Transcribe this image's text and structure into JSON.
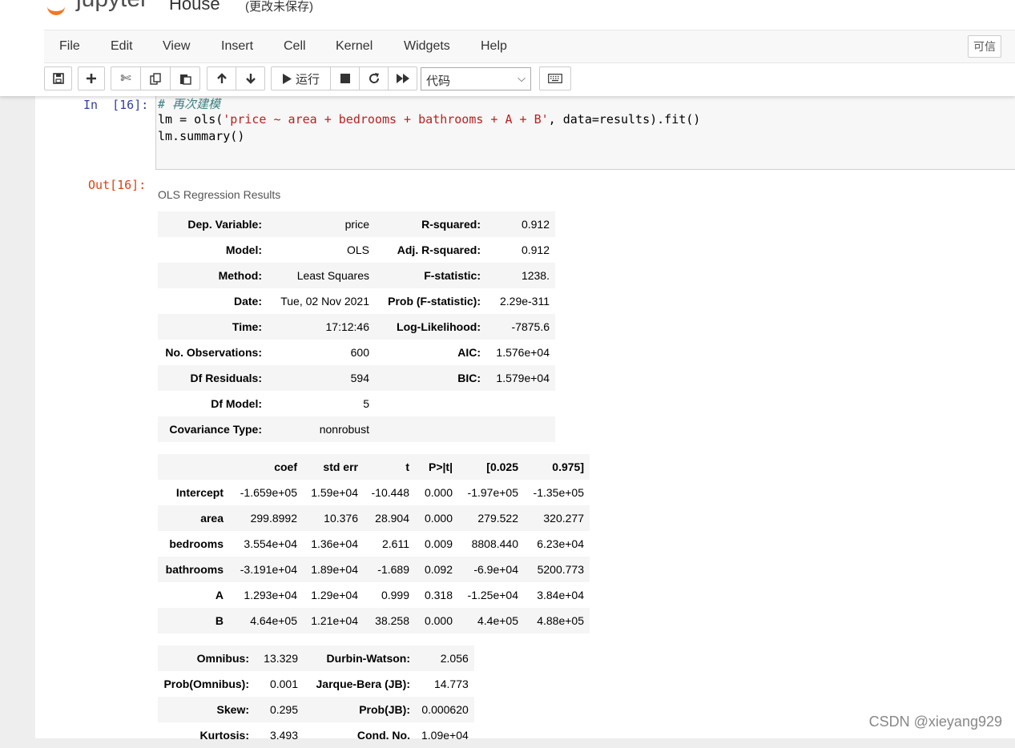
{
  "header": {
    "logo_text": "jupyter",
    "notebook_name": "House",
    "save_status": "(更改未保存)",
    "trusted": "可信"
  },
  "menu": [
    "File",
    "Edit",
    "View",
    "Insert",
    "Cell",
    "Kernel",
    "Widgets",
    "Help"
  ],
  "toolbar": {
    "run_label": "运行",
    "cell_type": "代码",
    "icons": [
      "save-icon",
      "plus-icon",
      "cut-icon",
      "copy-icon",
      "paste-icon",
      "arrow-up-icon",
      "arrow-down-icon",
      "run-icon",
      "stop-icon",
      "restart-icon",
      "fast-forward-icon",
      "keyboard-icon"
    ]
  },
  "cell": {
    "in_prompt": "In  [16]:",
    "out_prompt": "Out[16]:",
    "code": {
      "comment": "# 再次建模",
      "line2_a": "lm = ols(",
      "line2_str": "'price ~ area + bedrooms + bathrooms + A + B'",
      "line2_b": ", data=results).fit()",
      "line3": "lm.summary()"
    }
  },
  "summary": {
    "title": "OLS Regression Results",
    "top_table": [
      [
        "Dep. Variable:",
        "price",
        "R-squared:",
        "0.912"
      ],
      [
        "Model:",
        "OLS",
        "Adj. R-squared:",
        "0.912"
      ],
      [
        "Method:",
        "Least Squares",
        "F-statistic:",
        "1238."
      ],
      [
        "Date:",
        "Tue, 02 Nov 2021",
        "Prob (F-statistic):",
        "2.29e-311"
      ],
      [
        "Time:",
        "17:12:46",
        "Log-Likelihood:",
        "-7875.6"
      ],
      [
        "No. Observations:",
        "600",
        "AIC:",
        "1.576e+04"
      ],
      [
        "Df Residuals:",
        "594",
        "BIC:",
        "1.579e+04"
      ],
      [
        "Df Model:",
        "5",
        "",
        ""
      ],
      [
        "Covariance Type:",
        "nonrobust",
        "",
        ""
      ]
    ],
    "coef_header": [
      "",
      "coef",
      "std err",
      "t",
      "P>|t|",
      "[0.025",
      "0.975]"
    ],
    "coef_table": [
      [
        "Intercept",
        "-1.659e+05",
        "1.59e+04",
        "-10.448",
        "0.000",
        "-1.97e+05",
        "-1.35e+05"
      ],
      [
        "area",
        "299.8992",
        "10.376",
        "28.904",
        "0.000",
        "279.522",
        "320.277"
      ],
      [
        "bedrooms",
        "3.554e+04",
        "1.36e+04",
        "2.611",
        "0.009",
        "8808.440",
        "6.23e+04"
      ],
      [
        "bathrooms",
        "-3.191e+04",
        "1.89e+04",
        "-1.689",
        "0.092",
        "-6.9e+04",
        "5200.773"
      ],
      [
        "A",
        "1.293e+04",
        "1.29e+04",
        "0.999",
        "0.318",
        "-1.25e+04",
        "3.84e+04"
      ],
      [
        "B",
        "4.64e+05",
        "1.21e+04",
        "38.258",
        "0.000",
        "4.4e+05",
        "4.88e+05"
      ]
    ],
    "bottom_table": [
      [
        "Omnibus:",
        "13.329",
        "Durbin-Watson:",
        "2.056"
      ],
      [
        "Prob(Omnibus):",
        "0.001",
        "Jarque-Bera (JB):",
        "14.773"
      ],
      [
        "Skew:",
        "0.295",
        "Prob(JB):",
        "0.000620"
      ],
      [
        "Kurtosis:",
        "3.493",
        "Cond. No.",
        "1.09e+04"
      ]
    ]
  },
  "watermark": "CSDN @xieyang929"
}
